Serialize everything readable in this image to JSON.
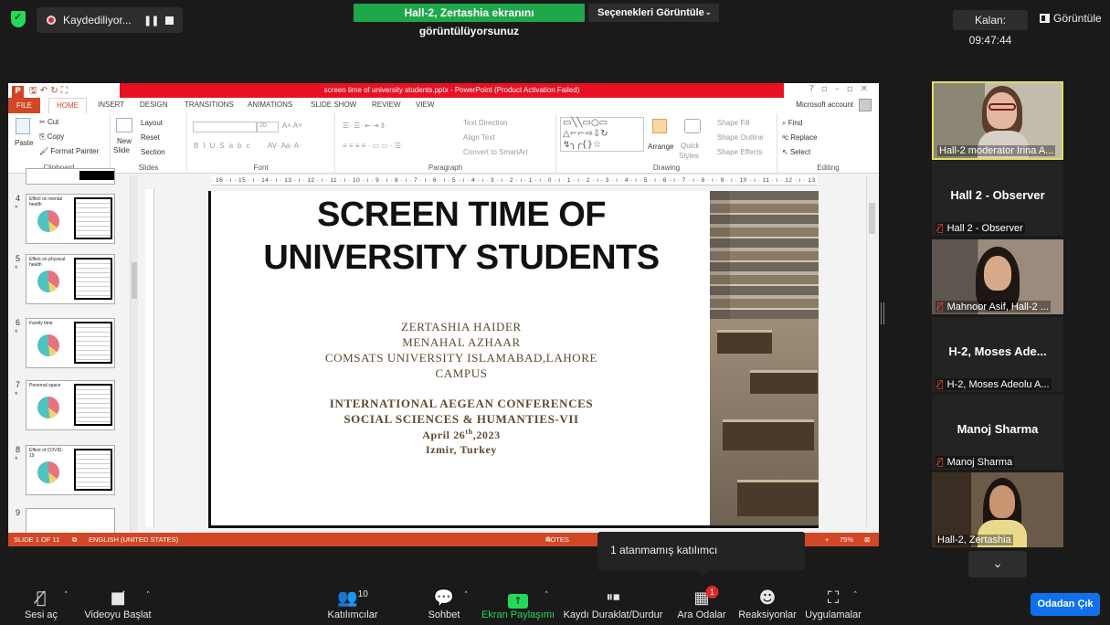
{
  "zoom_top": {
    "recording_label": "Kaydediliyor...",
    "share_banner": "Hall-2, Zertashia ekranını görüntülüyorsunuz",
    "view_options": "Seçenekleri Görüntüle",
    "timer": "Kalan: 09:47:44",
    "view_label": "Görüntüle"
  },
  "ppt": {
    "window_title": "screen time of university students.pptx - PowerPoint (Product Activation Failed)",
    "tabs": [
      "FILE",
      "HOME",
      "INSERT",
      "DESIGN",
      "TRANSITIONS",
      "ANIMATIONS",
      "SLIDE SHOW",
      "REVIEW",
      "VIEW"
    ],
    "account": "Microsoft account",
    "ribbon": {
      "clipboard": {
        "label": "Clipboard",
        "paste": "Paste",
        "cut": "Cut",
        "copy": "Copy",
        "format_painter": "Format Painter"
      },
      "slides": {
        "label": "Slides",
        "new_slide": "New",
        "new_slide2": "Slide",
        "layout": "Layout",
        "reset": "Reset",
        "section": "Section"
      },
      "font": {
        "label": "Font",
        "size": "20"
      },
      "paragraph": {
        "label": "Paragraph",
        "text_direction": "Text Direction",
        "align_text": "Align Text",
        "convert": "Convert to SmartArt"
      },
      "drawing": {
        "label": "Drawing",
        "arrange": "Arrange",
        "quick": "Quick",
        "styles": "Styles",
        "shape_fill": "Shape Fill",
        "shape_outline": "Shape Outline",
        "shape_effects": "Shape Effects"
      },
      "editing": {
        "label": "Editing",
        "find": "Find",
        "replace": "Replace",
        "select": "Select"
      }
    },
    "thumbnails": [
      {
        "num": "4",
        "title": "Effect on mental health"
      },
      {
        "num": "5",
        "title": "Effect on physical health"
      },
      {
        "num": "6",
        "title": "Family time"
      },
      {
        "num": "7",
        "title": "Personal space"
      },
      {
        "num": "8",
        "title": "Effect of COVID-19"
      },
      {
        "num": "9",
        "title": ""
      }
    ],
    "ruler": "· 16 · ı · 15 · ı · 14 · ı · 13 · ı · 12 · ı · 11 · ı · 10 · ı · 9 · ı · 8 · ı · 7 · ı · 6 · ı · 5 · ı · 4 · ı · 3 · ı · 2 · ı · 1 · ı · 0 · ı · 1 · ı · 2 · ı · 3 · ı · 4 · ı · 5 · ı · 6 · ı · 7 · ı · 8 · ı · 9 · ı · 10 · ı · 11 · ı · 12 · ı · 13 · ı · 14 · ı · 15 · ı · 16 ·",
    "slide": {
      "title_line1": "SCREEN TIME OF",
      "title_line2": "UNIVERSITY STUDENTS",
      "author1": "ZERTASHIA HAIDER",
      "author2": "MENAHAL AZHAAR",
      "institution1": "COMSATS UNIVERSITY ISLAMABAD,LAHORE",
      "institution2": "CAMPUS",
      "conference1": "INTERNATIONAL AEGEAN CONFERENCES",
      "conference2": "SOCIAL SCIENCES & HUMANTIES-VII",
      "date_prefix": "April 26",
      "date_sup": "th",
      "date_suffix": ",2023",
      "place": "Izmir, Turkey"
    },
    "status": {
      "slide_of": "SLIDE 1 OF 11",
      "language": "ENGLISH (UNITED STATES)",
      "notes": "NOTES",
      "zoom": "75%"
    }
  },
  "popup_unassigned": "1 atanmamış katılımcı",
  "participants": [
    {
      "label": "Hall-2 moderator Irina A...",
      "video": true,
      "active": true
    },
    {
      "title": "Hall 2 - Observer",
      "label": "Hall 2 - Observer",
      "video": false
    },
    {
      "label": "Mahnoor Asif, Hall-2 ...",
      "video": true
    },
    {
      "title": "H-2, Moses Ade...",
      "label": "H-2, Moses Adeolu A...",
      "video": false
    },
    {
      "title": "Manoj Sharma",
      "label": "Manoj Sharma",
      "video": false
    },
    {
      "label": "Hall-2, Zertashia",
      "video": true
    }
  ],
  "toolbar": {
    "audio": "Sesi aç",
    "video": "Videoyu Başlat",
    "participants": "Katılımcılar",
    "participants_count": "10",
    "chat": "Sohbet",
    "share": "Ekran Paylaşımı",
    "pause_record": "Kaydı Duraklat/Durdur",
    "breakout": "Ara Odalar",
    "breakout_badge": "1",
    "reactions": "Reaksiyonlar",
    "apps": "Uygulamalar",
    "leave": "Odadan Çık"
  },
  "colors": {
    "ppt_accent": "#d24726",
    "title_warning": "#e81123",
    "zoom_green": "#1ea849",
    "zoom_blue": "#0e72ed",
    "slide_serif_text": "#5f4a2f"
  }
}
